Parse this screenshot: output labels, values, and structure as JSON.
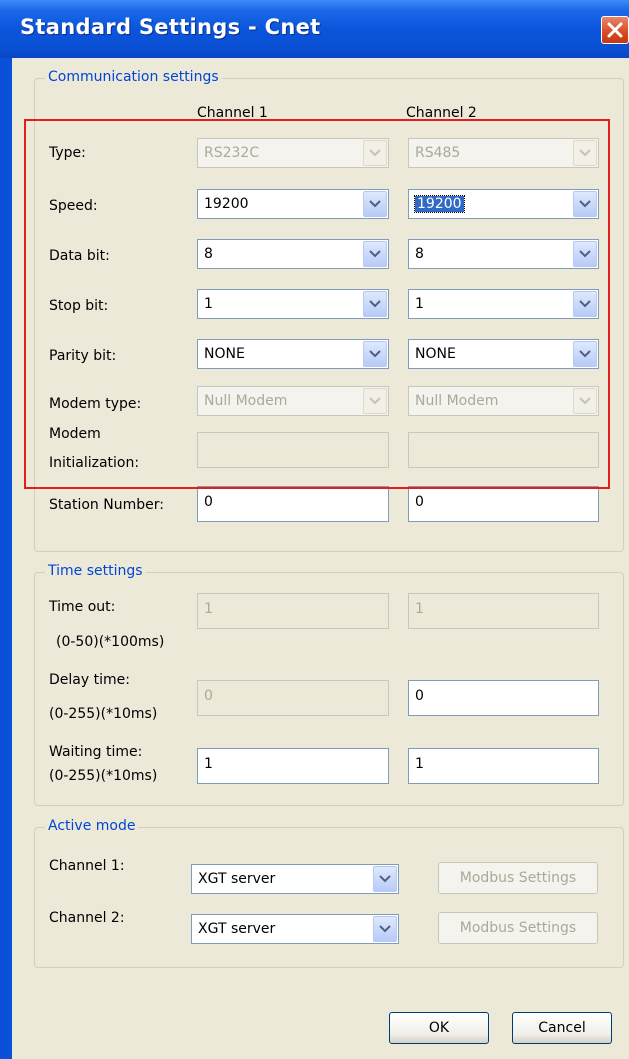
{
  "window": {
    "title": "Standard Settings - Cnet"
  },
  "communication": {
    "group_title": "Communication settings",
    "channel1_header": "Channel 1",
    "channel2_header": "Channel 2",
    "type": {
      "label": "Type:",
      "ch1": "RS232C",
      "ch2": "RS485"
    },
    "speed": {
      "label": "Speed:",
      "ch1": "19200",
      "ch2": "19200"
    },
    "data_bit": {
      "label": "Data bit:",
      "ch1": "8",
      "ch2": "8"
    },
    "stop_bit": {
      "label": "Stop bit:",
      "ch1": "1",
      "ch2": "1"
    },
    "parity_bit": {
      "label": "Parity bit:",
      "ch1": "NONE",
      "ch2": "NONE"
    },
    "modem_type": {
      "label": "Modem type:",
      "ch1": "Null Modem",
      "ch2": "Null Modem"
    },
    "modem_init": {
      "label_line1": "Modem",
      "label_line2": "Initialization:",
      "ch1": "",
      "ch2": ""
    },
    "station_number": {
      "label": "Station Number:",
      "ch1": "0",
      "ch2": "0"
    }
  },
  "time": {
    "group_title": "Time settings",
    "time_out": {
      "label": "Time out:",
      "range": "(0-50)(*100ms)",
      "ch1": "1",
      "ch2": "1"
    },
    "delay_time": {
      "label": "Delay time:",
      "range": "(0-255)(*10ms)",
      "ch1": "0",
      "ch2": "0"
    },
    "waiting_time": {
      "label": "Waiting time:",
      "range": "(0-255)(*10ms)",
      "ch1": "1",
      "ch2": "1"
    }
  },
  "active_mode": {
    "group_title": "Active mode",
    "channel1": {
      "label": "Channel 1:",
      "value": "XGT server",
      "button": "Modbus Settings"
    },
    "channel2": {
      "label": "Channel 2:",
      "value": "XGT server",
      "button": "Modbus Settings"
    }
  },
  "buttons": {
    "ok": "OK",
    "cancel": "Cancel"
  },
  "colors": {
    "title_bar": "#0a50d8",
    "highlight_border": "#e51d1d",
    "group_title": "#0046d5",
    "dialog_bg": "#ece9d8"
  }
}
